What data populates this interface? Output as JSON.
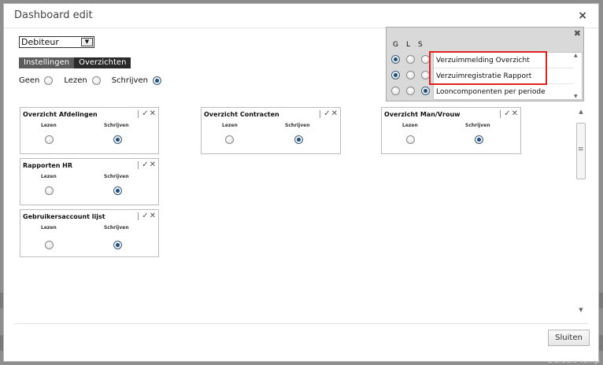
{
  "dialog": {
    "title": "Dashboard edit",
    "close_glyph": "×"
  },
  "select": {
    "value": "Debiteur",
    "arrow": "▼"
  },
  "tabs": [
    {
      "label": "Instellingen"
    },
    {
      "label": "Overzichten"
    }
  ],
  "global_perms": {
    "items": [
      {
        "label": "Geen",
        "selected": false
      },
      {
        "label": "Lezen",
        "selected": false
      },
      {
        "label": "Schrijven",
        "selected": true
      }
    ]
  },
  "cards": [
    {
      "title": "Overzicht Afdelingen",
      "col1": "Lezen",
      "col2": "Schrijven",
      "selected": "Schrijven"
    },
    {
      "title": "Overzicht Contracten",
      "col1": "Lezen",
      "col2": "Schrijven",
      "selected": "Schrijven"
    },
    {
      "title": "Overzicht Man/Vrouw",
      "col1": "Lezen",
      "col2": "Schrijven",
      "selected": "Schrijven"
    },
    {
      "title": "Rapporten HR",
      "col1": "Lezen",
      "col2": "Schrijven",
      "selected": "Schrijven"
    },
    {
      "title": "Gebruikersaccount lijst",
      "col1": "Lezen",
      "col2": "Schrijven",
      "selected": "Schrijven"
    }
  ],
  "card_controls": {
    "collapse_glyph": "✓",
    "remove_glyph": "✕"
  },
  "popup": {
    "headers": [
      "G",
      "L",
      "S"
    ],
    "close_glyph": "✖",
    "rows": [
      {
        "label": "Verzuimmelding Overzicht",
        "selected": "G"
      },
      {
        "label": "Verzuimregistratie Rapport",
        "selected": "G"
      },
      {
        "label": "Looncomponenten per periode",
        "selected": "S"
      }
    ]
  },
  "scrollbar": {
    "up": "▲",
    "down": "▼"
  },
  "footer": {
    "close_button": "Sluiten",
    "background_label": "Default Temp"
  },
  "colors": {
    "highlight": "#e02020",
    "radio_selected": "#1c4f78",
    "tab_inactive": "#5c5c5c",
    "tab_active": "#2a2a2a"
  }
}
